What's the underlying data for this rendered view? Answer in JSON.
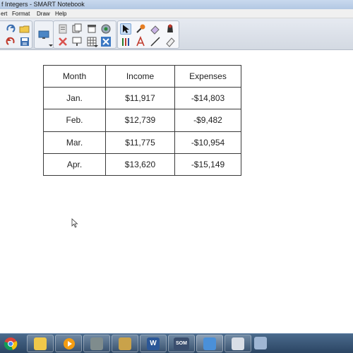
{
  "window": {
    "title": "f Integers - SMART Notebook"
  },
  "menu": {
    "items": [
      "ert",
      "Format",
      "Draw",
      "Help"
    ]
  },
  "colors": {
    "accent": "#2b4563",
    "table_border": "#3a3a3a"
  },
  "toolbar": {
    "icons": [
      "redo-icon",
      "open-folder-icon",
      "undo-icon",
      "save-icon",
      "screen-display-icon",
      "paste-icon",
      "delete-icon",
      "screen-shade-icon",
      "table-icon",
      "capture-icon",
      "select-icon",
      "magic-pen-icon",
      "eraser-icon",
      "fill-icon",
      "pens-icon",
      "text-icon",
      "line-icon",
      "shape-eraser-icon"
    ]
  },
  "table": {
    "headers": [
      "Month",
      "Income",
      "Expenses"
    ],
    "rows": [
      [
        "Jan.",
        "$11,917",
        "-$14,803"
      ],
      [
        "Feb.",
        "$12,739",
        "-$9,482"
      ],
      [
        "Mar.",
        "$11,775",
        "-$10,954"
      ],
      [
        "Apr.",
        "$13,620",
        "-$15,149"
      ]
    ]
  },
  "taskbar": {
    "icons": [
      "chrome-icon",
      "explorer-icon",
      "media-player-icon",
      "smart-board-icon",
      "tools-icon",
      "folders-icon",
      "word-icon",
      "som-icon",
      "notebook-icon",
      "document-icon",
      "window-icon"
    ],
    "labels": {
      "word": "W",
      "som": "SOM"
    }
  }
}
